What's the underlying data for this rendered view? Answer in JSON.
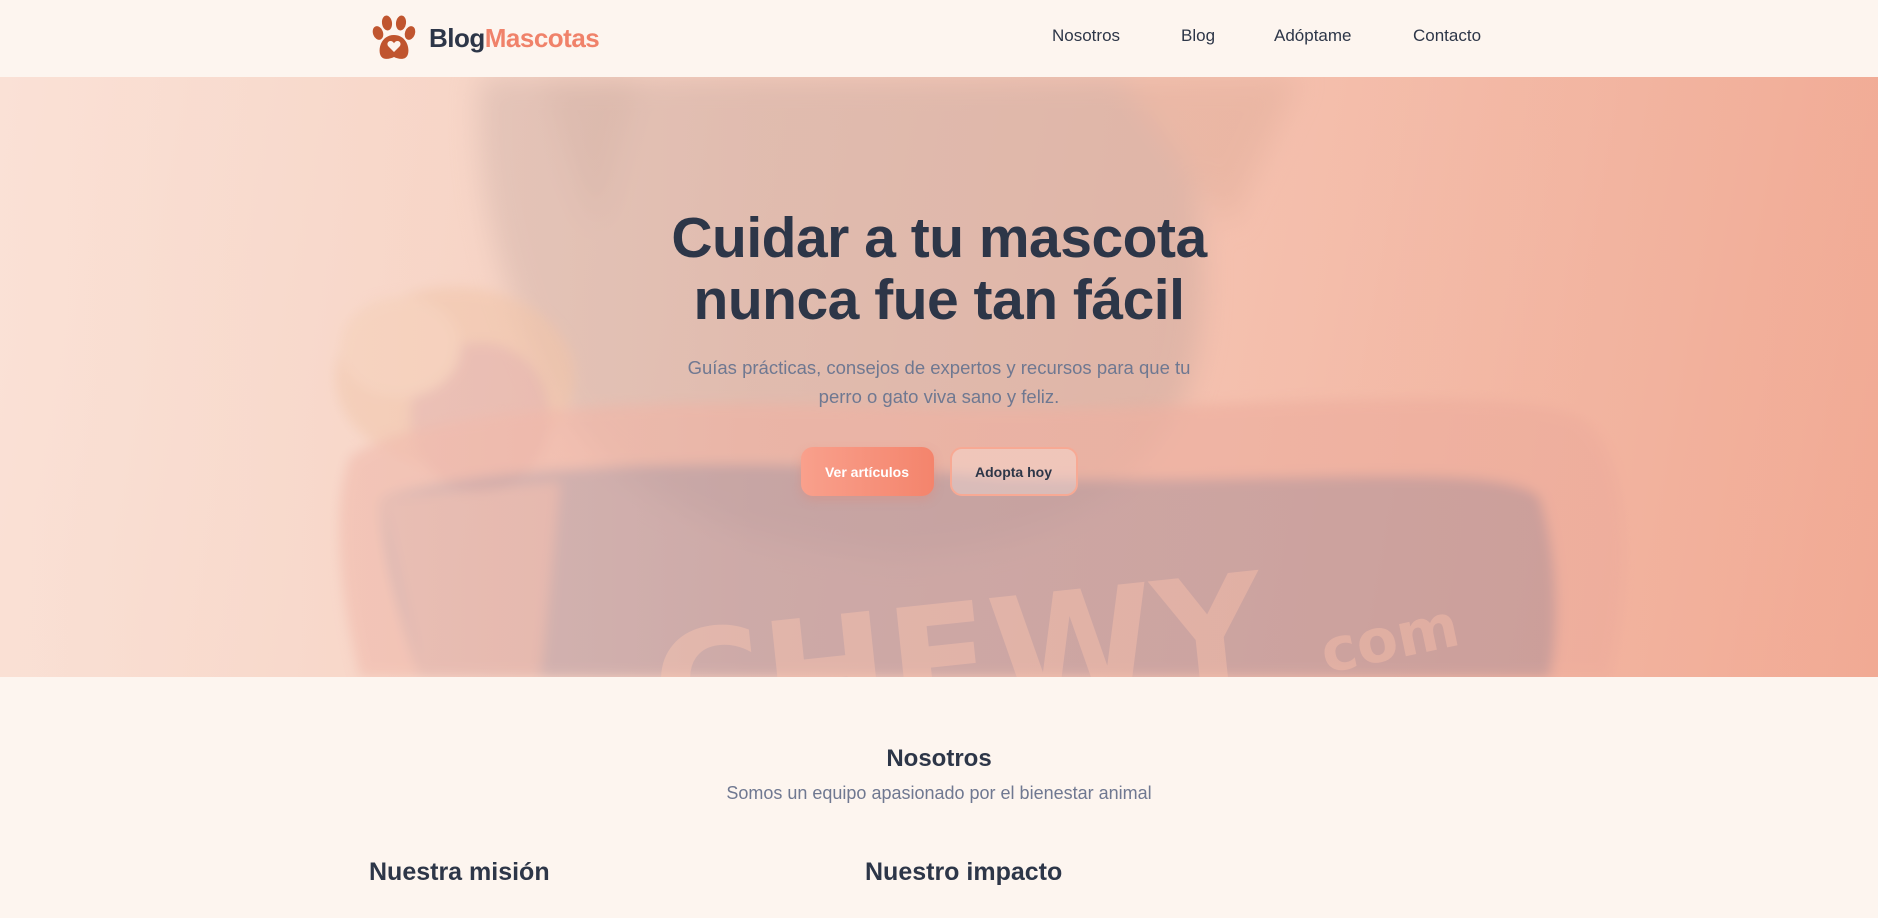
{
  "brand": {
    "name_part1": "Blog",
    "name_part2": "Mascotas",
    "logo_icon": "paw-heart-icon",
    "accent_color": "#f0826a",
    "logo_color": "#c0552f"
  },
  "nav": {
    "items": [
      {
        "label": "Nosotros"
      },
      {
        "label": "Blog"
      },
      {
        "label": "Adóptame"
      },
      {
        "label": "Contacto"
      }
    ]
  },
  "hero": {
    "title": "Cuidar a tu mascota nunca fue tan fácil",
    "subtitle": "Guías prácticas, consejos de expertos y recursos para que tu perro o gato viva sano y feliz.",
    "primary_button": "Ver artículos",
    "secondary_button": "Adopta hoy",
    "background_watermark": "com"
  },
  "about": {
    "title": "Nosotros",
    "subtitle": "Somos un equipo apasionado por el bienestar animal",
    "columns": [
      {
        "title": "Nuestra misión"
      },
      {
        "title": "Nuestro impacto"
      }
    ]
  }
}
